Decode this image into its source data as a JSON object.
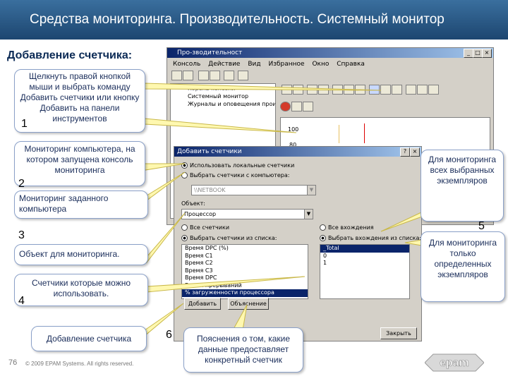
{
  "header": {
    "title": "Средства мониторинга. Производительность. Системный монитор"
  },
  "section_title": "Добавление счетчика:",
  "perf_window": {
    "title": "Про-зводительност",
    "menu": [
      "Консоль",
      "Действие",
      "Вид",
      "Избранное",
      "Окно",
      "Справка"
    ],
    "tree": [
      "Корень консоли",
      "Системный монитор",
      "Журналы и оповещения производ"
    ],
    "graph_label": "100",
    "graph_label2": "80"
  },
  "dialog": {
    "title": "Добавить счетчики",
    "close_glyph": "×",
    "help_glyph": "?",
    "radio_local": "Использовать локальные счетчики",
    "radio_remote": "Выбрать счетчики с компьютера:",
    "computer_value": "\\\\NETBOOK",
    "object_label": "Объект:",
    "object_value": "Процессор",
    "radio_all_counters": "Все счетчики",
    "radio_select_counters": "Выбрать счетчики из списка:",
    "counters": [
      "Время DPC (%)",
      "Время C1",
      "Время C2",
      "Время C3",
      "Время DPC",
      "Время прерываний",
      "% загруженности процессора"
    ],
    "selected_counter_index": 6,
    "radio_all_instances": "Все вхождения",
    "radio_select_instances": "Выбрать вхождения из списка:",
    "instances": [
      "_Total",
      "0",
      "1"
    ],
    "selected_instance_index": 0,
    "add_button": "Добавить",
    "explain_button": "Объяснение",
    "close_button": "Закрыть"
  },
  "callouts": {
    "c1": "Щелкнуть правой кнопкой мыши и выбрать команду Добавить счетчики или кнопку Добавить на панели инструментов",
    "c2": "Мониторинг компьютера, на котором запущена консоль мониторинга",
    "c2b": "Мониторинг заданного компьютера",
    "c3": "Объект для мониторинга.",
    "c4": "Счетчики которые можно использовать.",
    "c5": "Добавление счетчика",
    "c6": "Пояснения о том, какие данные предоставляет конкретный счетчик",
    "c_right_top": "Для мониторинга всех выбранных экземпляров",
    "c_right_bottom": "Для мониторинга только определенных экземпляров"
  },
  "numbers": [
    "1",
    "2",
    "3",
    "4",
    "5",
    "6"
  ],
  "footer": {
    "page": "76",
    "copyright": "© 2009 EPAM Systems. All rights reserved.",
    "logo_text": "epam"
  }
}
